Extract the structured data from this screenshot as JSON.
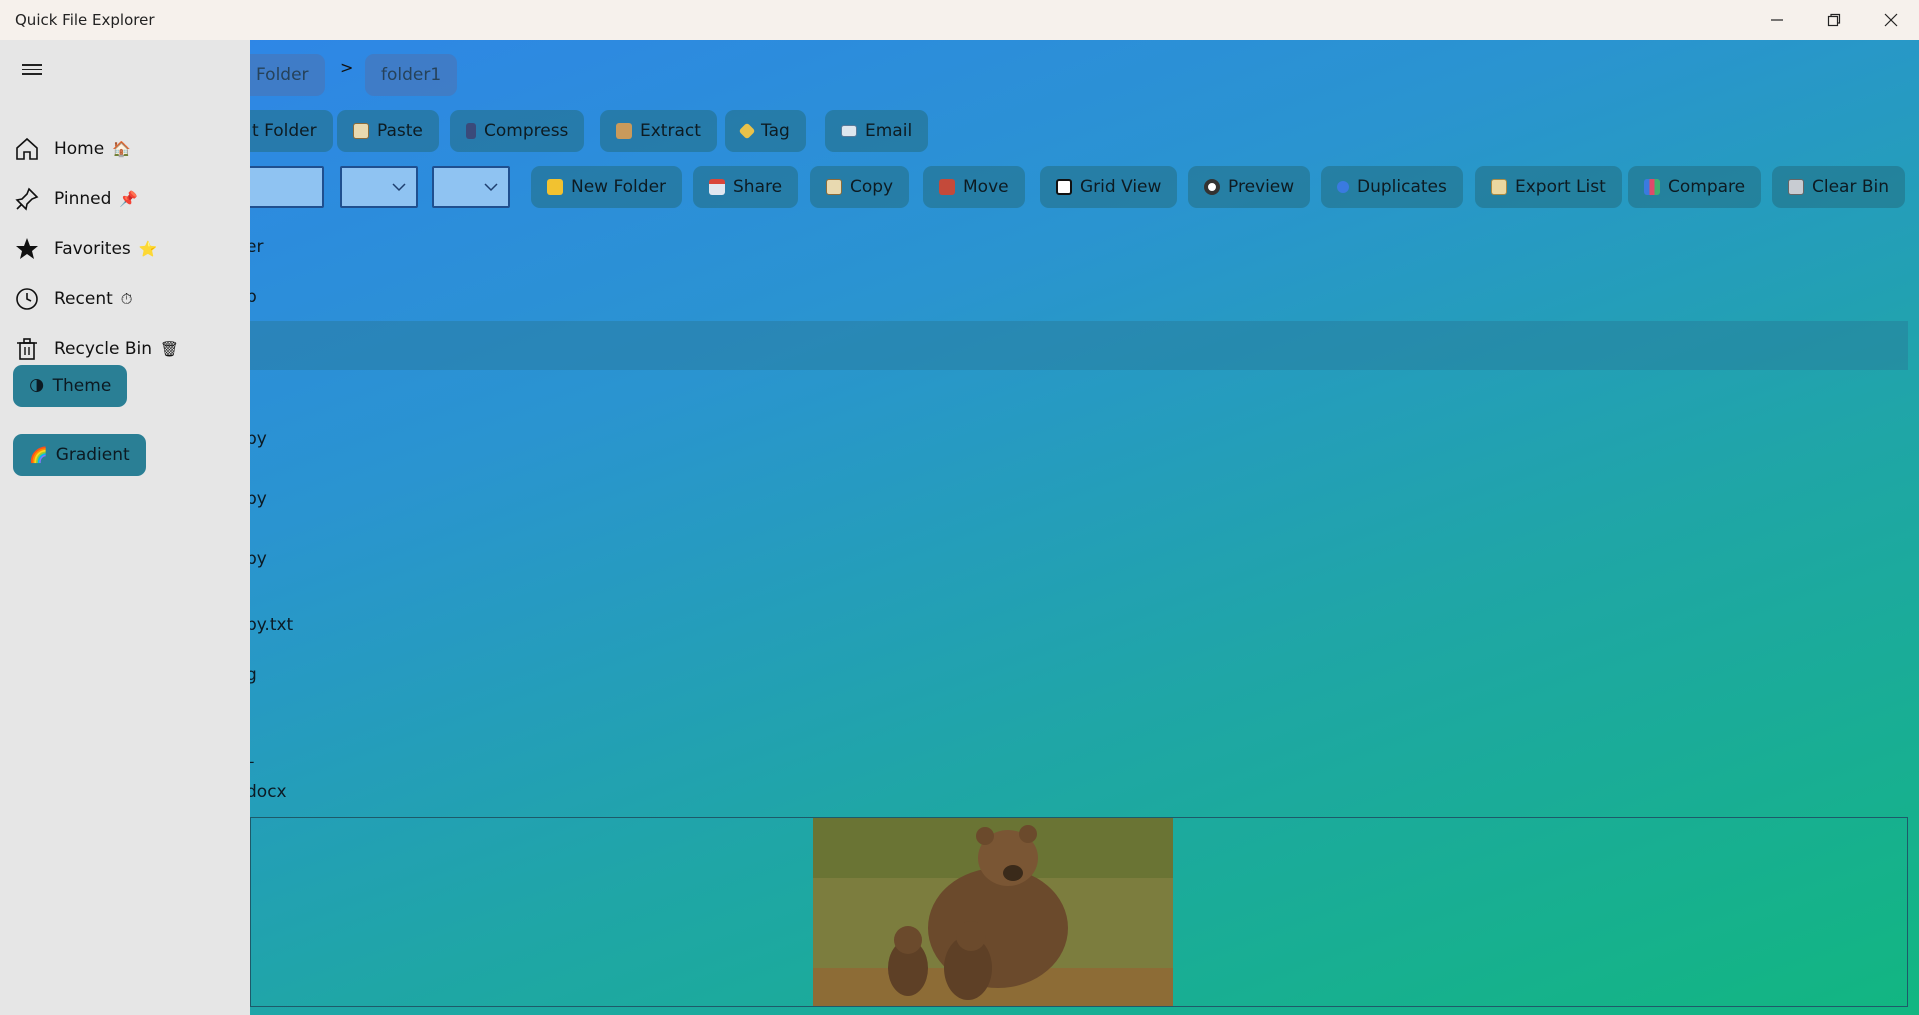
{
  "app": {
    "title": "Quick File Explorer"
  },
  "breadcrumb": {
    "items": [
      "Folder",
      "folder1"
    ],
    "separator": ">"
  },
  "toolbar1": [
    {
      "label": "t Folder",
      "icon": "folder-icon"
    },
    {
      "label": "Paste",
      "icon": "clipboard-icon"
    },
    {
      "label": "Compress",
      "icon": "compress-icon"
    },
    {
      "label": "Extract",
      "icon": "package-icon"
    },
    {
      "label": "Tag",
      "icon": "tag-icon"
    },
    {
      "label": "Email",
      "icon": "email-icon"
    }
  ],
  "toolbar2": [
    {
      "label": "New Folder",
      "icon": "folder-icon"
    },
    {
      "label": "Share",
      "icon": "share-icon"
    },
    {
      "label": "Copy",
      "icon": "clipboard-icon"
    },
    {
      "label": "Move",
      "icon": "move-icon"
    },
    {
      "label": "Grid View",
      "icon": "checkbox-icon"
    },
    {
      "label": "Preview",
      "icon": "eye-icon"
    },
    {
      "label": "Duplicates",
      "icon": "duplicates-icon"
    },
    {
      "label": "Export List",
      "icon": "scroll-icon"
    },
    {
      "label": "Compare",
      "icon": "chart-icon"
    },
    {
      "label": "Clear Bin",
      "icon": "trash-icon"
    }
  ],
  "files": [
    "er",
    "p",
    "",
    "",
    "py",
    "py",
    "py",
    "py.txt",
    "g",
    "",
    "–",
    "docx"
  ],
  "sidebar": {
    "items": [
      {
        "label": "Home",
        "emoji": "🏠",
        "icon": "home-icon"
      },
      {
        "label": "Pinned",
        "emoji": "📌",
        "icon": "pin-icon"
      },
      {
        "label": "Favorites",
        "emoji": "⭐",
        "icon": "star-icon"
      },
      {
        "label": "Recent",
        "emoji": "⏱",
        "icon": "clock-icon"
      },
      {
        "label": "Recycle Bin",
        "emoji": "🗑",
        "icon": "recycle-bin-icon"
      }
    ],
    "theme_label": "Theme",
    "theme_emoji": "🌗",
    "gradient_label": "Gradient",
    "gradient_emoji": "🌈"
  },
  "colors": {
    "sidebar_bg": "#e6e6e6",
    "chip_bg": "#2a7f95",
    "gradient_start": "#2f84ea",
    "gradient_end": "#12b681"
  }
}
